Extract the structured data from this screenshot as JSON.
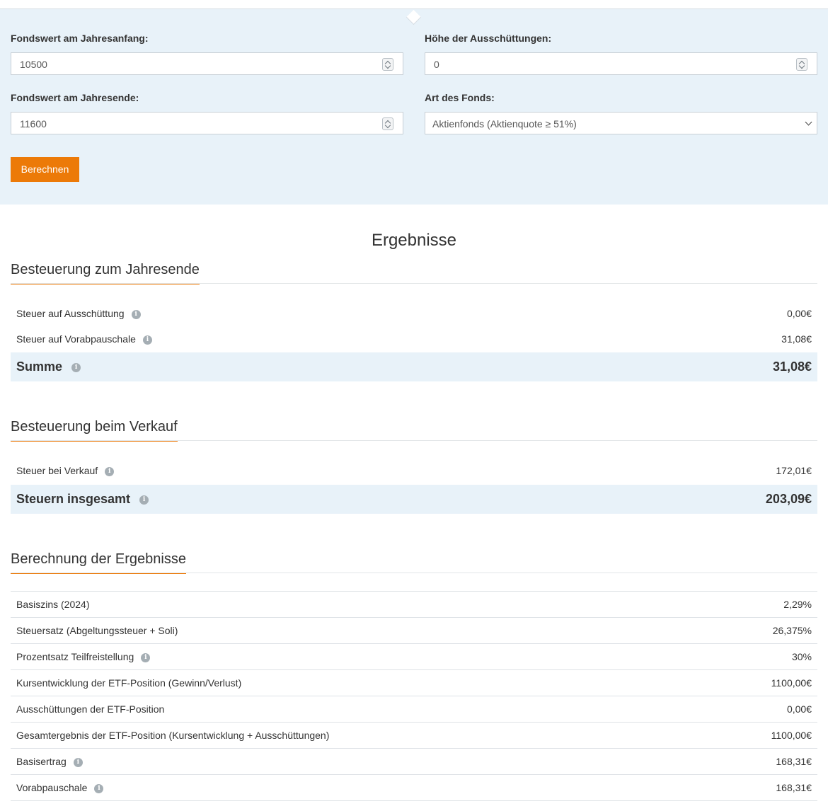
{
  "form": {
    "start_value_label": "Fondswert am Jahresanfang:",
    "start_value": "10500",
    "end_value_label": "Fondswert am Jahresende:",
    "end_value": "11600",
    "distribution_label": "Höhe der Ausschüttungen:",
    "distribution_value": "0",
    "fund_type_label": "Art des Fonds:",
    "fund_type_selected": "Aktienfonds (Aktienquote ≥ 51%)",
    "submit_label": "Berechnen"
  },
  "results": {
    "title": "Ergebnisse",
    "year_end": {
      "title": "Besteuerung zum Jahresende",
      "rows": [
        {
          "label": "Steuer auf Ausschüttung",
          "value": "0,00€"
        },
        {
          "label": "Steuer auf Vorabpauschale",
          "value": "31,08€"
        }
      ],
      "sum_label": "Summe",
      "sum_value": "31,08€"
    },
    "sale": {
      "title": "Besteuerung beim Verkauf",
      "rows": [
        {
          "label": "Steuer bei Verkauf",
          "value": "172,01€"
        }
      ],
      "total_label": "Steuern insgesamt",
      "total_value": "203,09€"
    },
    "calculation": {
      "title": "Berechnung der Ergebnisse",
      "rows": [
        {
          "label": "Basiszins (2024)",
          "value": "2,29%"
        },
        {
          "label": "Steuersatz (Abgeltungssteuer + Soli)",
          "value": "26,375%"
        },
        {
          "label": "Prozentsatz Teilfreistellung",
          "value": "30%"
        },
        {
          "label": "Kursentwicklung der ETF-Position (Gewinn/Verlust)",
          "value": "1100,00€"
        },
        {
          "label": "Ausschüttungen der ETF-Position",
          "value": "0,00€"
        },
        {
          "label": "Gesamtergebnis der ETF-Position (Kursentwicklung + Ausschüttungen)",
          "value": "1100,00€"
        },
        {
          "label": "Basisertrag",
          "value": "168,31€"
        },
        {
          "label": "Vorabpauschale",
          "value": "168,31€"
        }
      ]
    }
  },
  "icons": {
    "info": "info-icon",
    "info_glyph": "i"
  },
  "colors": {
    "accent": "#ec7a08",
    "panel": "#e8f2f9"
  }
}
